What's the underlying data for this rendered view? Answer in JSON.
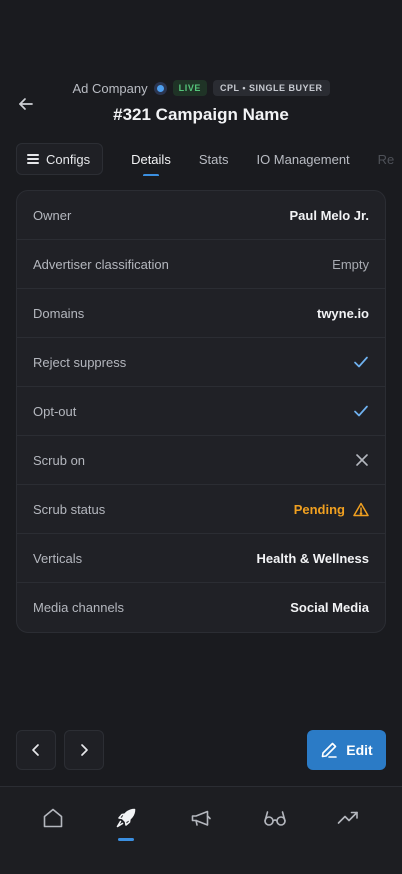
{
  "header": {
    "company": "Ad Company",
    "status_badge": "LIVE",
    "type_badge": "CPL • SINGLE BUYER",
    "title": "#321 Campaign Name"
  },
  "tabs": {
    "configs_label": "Configs",
    "items": [
      "Details",
      "Stats",
      "IO Management",
      "Re"
    ],
    "active": "Details"
  },
  "details": {
    "rows": [
      {
        "label": "Owner",
        "value": "Paul Melo Jr."
      },
      {
        "label": "Advertiser classification",
        "value": "Empty"
      },
      {
        "label": "Domains",
        "value": "twyne.io"
      },
      {
        "label": "Reject suppress",
        "icon": "check-icon"
      },
      {
        "label": "Opt-out",
        "icon": "check-icon"
      },
      {
        "label": "Scrub on",
        "icon": "x-icon"
      },
      {
        "label": "Scrub status",
        "value": "Pending",
        "icon": "warning-icon"
      },
      {
        "label": "Verticals",
        "value": "Health & Wellness"
      },
      {
        "label": "Media channels",
        "value": "Social Media"
      }
    ]
  },
  "actions": {
    "edit_label": "Edit"
  },
  "bottom_nav": {
    "items": [
      "home-icon",
      "rocket-icon",
      "megaphone-icon",
      "glasses-icon",
      "trending-icon"
    ],
    "active": "rocket-icon"
  },
  "colors": {
    "accent": "#3b8fe0",
    "edit_button": "#2b7bc6",
    "live": "#55c47a",
    "warning": "#f0a020",
    "background": "#1a1b1f"
  }
}
